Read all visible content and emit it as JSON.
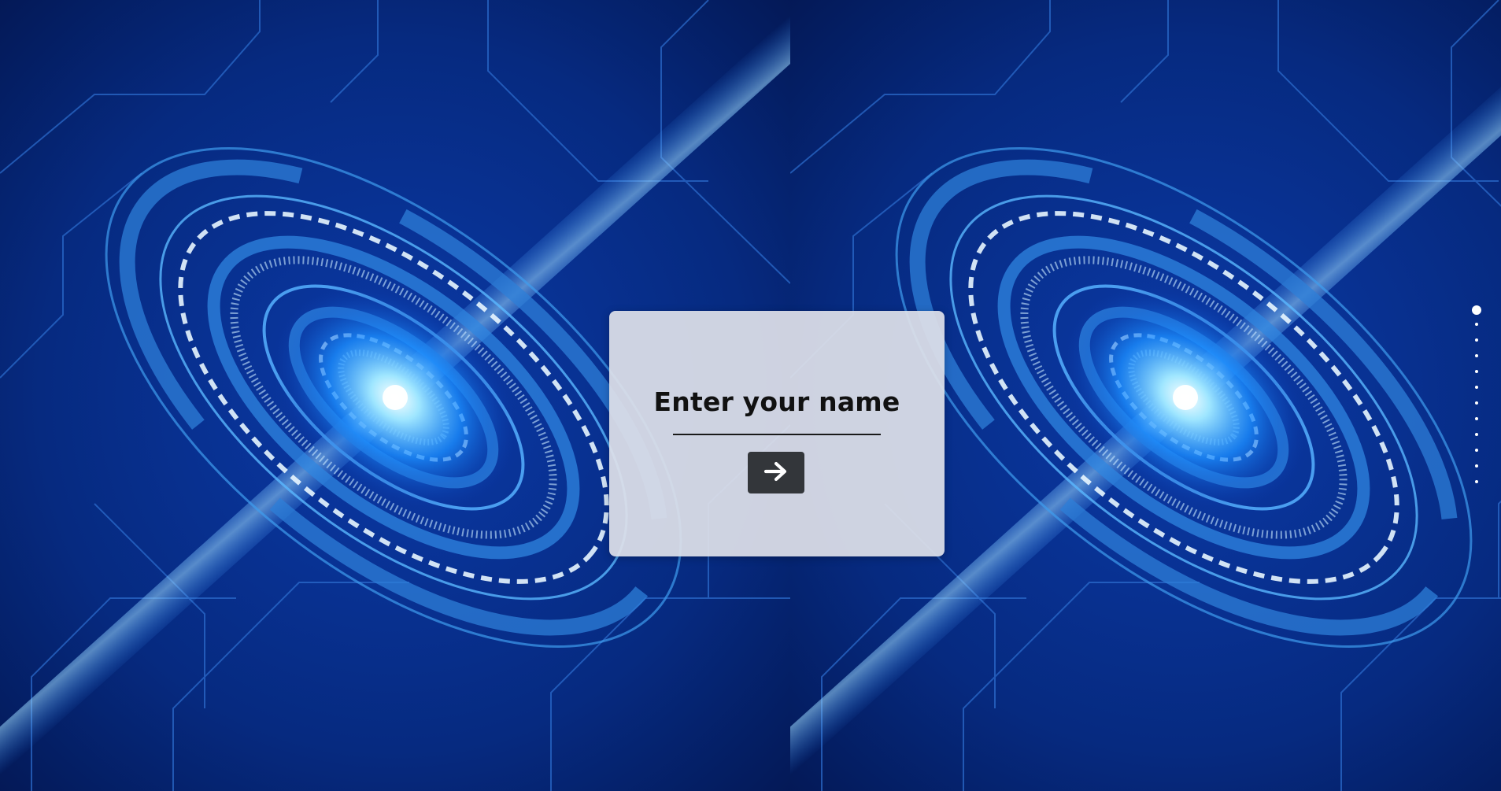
{
  "modal": {
    "title": "Enter your name",
    "name_value": "",
    "name_placeholder": "",
    "submit_icon": "arrow-right-icon"
  },
  "pagination": {
    "active_index": 0,
    "total": 12
  },
  "colors": {
    "background": "#041a5a",
    "glow": "#6fd0ff",
    "modal_bg": "#dfe0e7",
    "button_bg": "#33363a"
  }
}
